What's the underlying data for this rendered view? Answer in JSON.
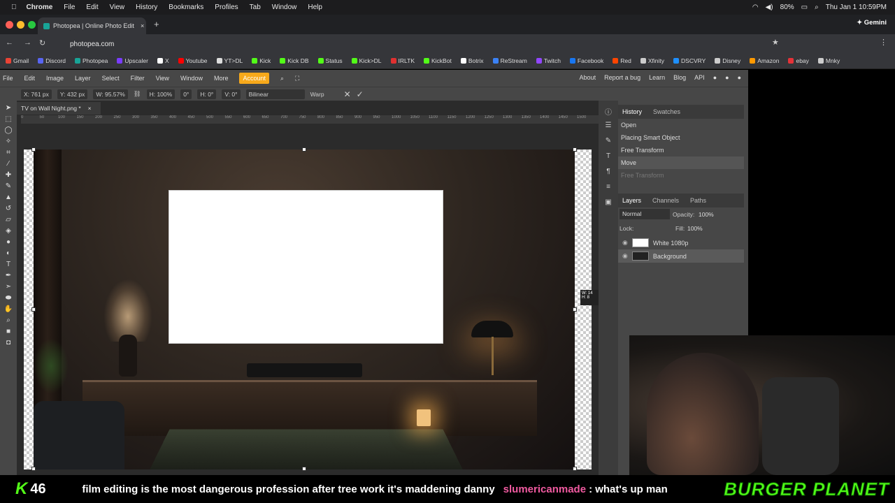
{
  "macos": {
    "app": "Chrome",
    "menus": [
      "File",
      "Edit",
      "View",
      "History",
      "Bookmarks",
      "Profiles",
      "Tab",
      "Window",
      "Help"
    ],
    "battery": "80%",
    "datetime": "Thu Jan 1  10:59PM"
  },
  "browser": {
    "tab_title": "Photopea | Online Photo Edit",
    "url": "photopea.com",
    "gemini_label": "Gemini",
    "bookmarks": [
      {
        "label": "Gmail",
        "color": "#ea4335"
      },
      {
        "label": "Discord",
        "color": "#5865f2"
      },
      {
        "label": "Photopea",
        "color": "#18a497"
      },
      {
        "label": "Upscaler",
        "color": "#7a3cff"
      },
      {
        "label": "X",
        "color": "#ffffff"
      },
      {
        "label": "Youtube",
        "color": "#ff0000"
      },
      {
        "label": "YT>DL",
        "color": "#e8e8e8"
      },
      {
        "label": "Kick",
        "color": "#53fc18"
      },
      {
        "label": "Kick DB",
        "color": "#53fc18"
      },
      {
        "label": "Status",
        "color": "#53fc18"
      },
      {
        "label": "Kick>DL",
        "color": "#53fc18"
      },
      {
        "label": "IRLTK",
        "color": "#e03030"
      },
      {
        "label": "KickBot",
        "color": "#53fc18"
      },
      {
        "label": "Botrix",
        "color": "#ffffff"
      },
      {
        "label": "ReStream",
        "color": "#3b82f6"
      },
      {
        "label": "Twitch",
        "color": "#9146ff"
      },
      {
        "label": "Facebook",
        "color": "#1877f2"
      },
      {
        "label": "Red",
        "color": "#ff4500"
      },
      {
        "label": "Xfinity",
        "color": "#cccccc"
      },
      {
        "label": "DSCVRY",
        "color": "#1e90ff"
      },
      {
        "label": "Disney",
        "color": "#cccccc"
      },
      {
        "label": "Amazon",
        "color": "#ff9900"
      },
      {
        "label": "ebay",
        "color": "#e53238"
      },
      {
        "label": "Mnky",
        "color": "#cccccc"
      }
    ]
  },
  "photopea": {
    "menu": [
      "File",
      "Edit",
      "Image",
      "Layer",
      "Select",
      "Filter",
      "View",
      "Window",
      "More"
    ],
    "account_label": "Account",
    "right_links": [
      "About",
      "Report a bug",
      "Learn",
      "Blog",
      "API"
    ],
    "options": {
      "x": "X: 761 px",
      "y": "Y: 432 px",
      "w": "W: 95.57%",
      "h": "H: 100%",
      "angle": "0°",
      "hskew": "H: 0°",
      "vskew": "V: 0°",
      "interp": "Bilinear",
      "warp": "Warp"
    },
    "doc_tab": "TV on Wall Night.png *",
    "ruler": [
      "0",
      "50",
      "100",
      "150",
      "200",
      "250",
      "300",
      "350",
      "400",
      "450",
      "500",
      "550",
      "600",
      "650",
      "700",
      "750",
      "800",
      "850",
      "900",
      "950",
      "1000",
      "1050",
      "1100",
      "1150",
      "1200",
      "1250",
      "1300",
      "1350",
      "1400",
      "1450",
      "1500"
    ],
    "history": {
      "tabs": [
        "History",
        "Swatches"
      ],
      "items": [
        "Open",
        "Placing Smart Object",
        "Free Transform",
        "Move",
        "Free Transform"
      ]
    },
    "layers": {
      "tabs": [
        "Layers",
        "Channels",
        "Paths"
      ],
      "blend": "Normal",
      "opacity_label": "Opacity:",
      "opacity": "100%",
      "lock_label": "Lock:",
      "fill_label": "Fill:",
      "fill": "100%",
      "items": [
        "White 1080p",
        "Background"
      ]
    },
    "zoom_tip": "W: 14\nH: 8"
  },
  "stream": {
    "viewer_count": "46",
    "kick_logo": "K",
    "message": "film editing is the most dangerous profession after tree work it's maddening danny",
    "chat_user": "slumericanmade",
    "chat_text": ": what's up man",
    "brand": "BURGER PLANET"
  }
}
